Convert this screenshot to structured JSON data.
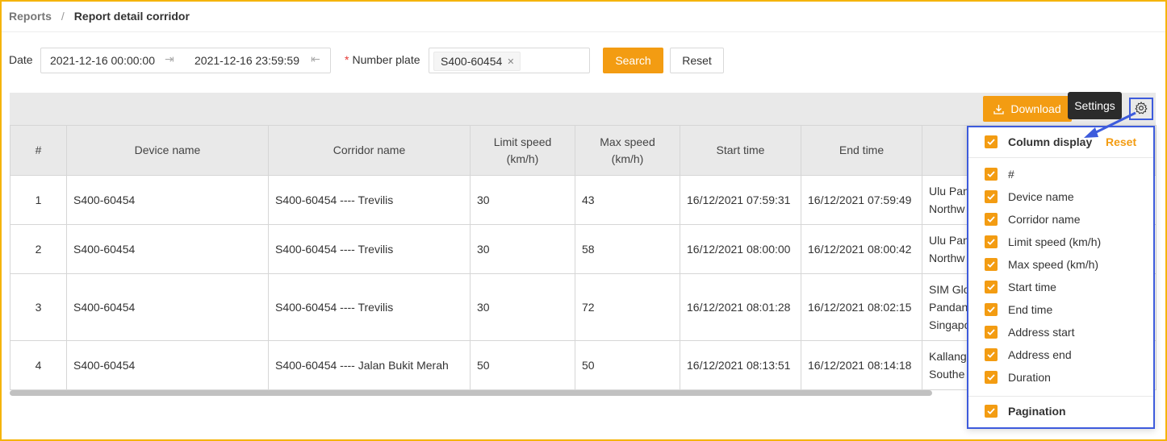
{
  "breadcrumb": {
    "root": "Reports",
    "separator": "/",
    "current": "Report detail corridor"
  },
  "filters": {
    "date_label": "Date",
    "date_start": "2021-12-16 00:00:00",
    "date_end": "2021-12-16 23:59:59",
    "required_mark": "*",
    "plate_label": "Number plate",
    "plate_tag": "S400-60454",
    "search_label": "Search",
    "reset_label": "Reset"
  },
  "toolbar": {
    "download_label": "Download",
    "settings_tooltip": "Settings"
  },
  "table": {
    "headers": [
      "#",
      "Device name",
      "Corridor name",
      "Limit speed (km/h)",
      "Max speed (km/h)",
      "Start time",
      "End time",
      ""
    ],
    "rows": [
      [
        "1",
        "S400-60454",
        "S400-60454 ---- Trevilis",
        "30",
        "43",
        "16/12/2021 07:59:31",
        "16/12/2021 07:59:49",
        [
          "Ulu Pan",
          "Northw"
        ]
      ],
      [
        "2",
        "S400-60454",
        "S400-60454 ---- Trevilis",
        "30",
        "58",
        "16/12/2021 08:00:00",
        "16/12/2021 08:00:42",
        [
          "Ulu Pan",
          "Northw"
        ]
      ],
      [
        "3",
        "S400-60454",
        "S400-60454 ---- Trevilis",
        "30",
        "72",
        "16/12/2021 08:01:28",
        "16/12/2021 08:02:15",
        [
          "SIM Glo",
          "Pandan",
          "Singapo"
        ]
      ],
      [
        "4",
        "S400-60454",
        "S400-60454 ---- Jalan Bukit Merah",
        "50",
        "50",
        "16/12/2021 08:13:51",
        "16/12/2021 08:14:18",
        [
          "Kallang",
          "Southe"
        ]
      ]
    ]
  },
  "column_panel": {
    "title": "Column display",
    "reset_label": "Reset",
    "columns": [
      "#",
      "Device name",
      "Corridor name",
      "Limit speed (km/h)",
      "Max speed (km/h)",
      "Start time",
      "End time",
      "Address start",
      "Address end",
      "Duration"
    ],
    "pagination_label": "Pagination"
  },
  "colors": {
    "accent": "#f39c12",
    "highlight": "#3d5bdc",
    "frame": "#f5b40a"
  }
}
